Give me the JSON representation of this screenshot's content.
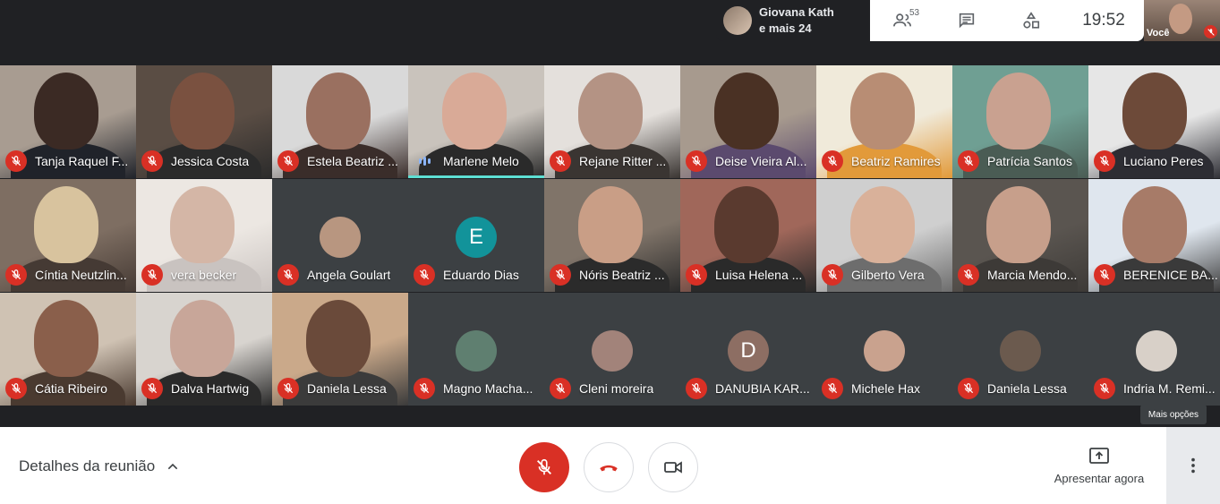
{
  "presenter_chip": {
    "line1": "Giovana Kath",
    "line2": "e mais 24"
  },
  "top_controls": {
    "participants_count": "53",
    "clock": "19:52"
  },
  "self_view": {
    "label": "Você"
  },
  "tiles": [
    {
      "name": "Tanja Raquel F...",
      "kind": "video",
      "colors": [
        "#a89c91",
        "#3b2a24",
        "#20232a"
      ]
    },
    {
      "name": "Jessica Costa",
      "kind": "video",
      "colors": [
        "#5a4d44",
        "#7a5140",
        "#2b2b2b"
      ]
    },
    {
      "name": "Estela Beatriz ...",
      "kind": "video",
      "colors": [
        "#d9d9d9",
        "#9a7060",
        "#3a2d2a"
      ]
    },
    {
      "name": "Marlene Melo",
      "kind": "video",
      "speaking": true,
      "colors": [
        "#c9c3bc",
        "#d9aa97",
        "#2a2a2a"
      ]
    },
    {
      "name": "Rejane Ritter ...",
      "kind": "video",
      "colors": [
        "#e4e0dc",
        "#b49384",
        "#3a3532"
      ]
    },
    {
      "name": "Deise Vieira Al...",
      "kind": "video",
      "colors": [
        "#a79a8e",
        "#4a3124",
        "#5b4a6e"
      ]
    },
    {
      "name": "Beatriz Ramires",
      "kind": "video",
      "colors": [
        "#f0eada",
        "#b88d74",
        "#e29a3a"
      ]
    },
    {
      "name": "Patrícia Santos",
      "kind": "video",
      "colors": [
        "#6f9f93",
        "#c9a190",
        "#4a5c54"
      ]
    },
    {
      "name": "Luciano Peres",
      "kind": "video",
      "colors": [
        "#e6e6e6",
        "#6d4a39",
        "#2d2d33"
      ]
    },
    {
      "name": "Cíntia Neutzlin...",
      "kind": "video",
      "colors": [
        "#7e6e62",
        "#d8c39e",
        "#453a34"
      ]
    },
    {
      "name": "vera becker",
      "kind": "video",
      "colors": [
        "#ece7e2",
        "#d4b6a6",
        "#c9c3c0"
      ]
    },
    {
      "name": "Angela Goulart",
      "kind": "avatar",
      "avatar_color": "#b89680"
    },
    {
      "name": "Eduardo Dias",
      "kind": "letter",
      "letter": "E",
      "avatar_color": "#12939a"
    },
    {
      "name": "Nóris Beatriz ...",
      "kind": "video",
      "colors": [
        "#807469",
        "#c99e86",
        "#2b2b2b"
      ]
    },
    {
      "name": "Luisa Helena ...",
      "kind": "video",
      "colors": [
        "#a0675a",
        "#5a3a2f",
        "#2a2a2a"
      ]
    },
    {
      "name": "Gilberto Vera",
      "kind": "video",
      "colors": [
        "#cfcfcf",
        "#d9b19a",
        "#6d6d6d"
      ]
    },
    {
      "name": "Marcia Mendo...",
      "kind": "video",
      "colors": [
        "#5a5550",
        "#c79f8b",
        "#3d3a37"
      ]
    },
    {
      "name": "BERENICE BA...",
      "kind": "video",
      "colors": [
        "#dfe6ee",
        "#a77b68",
        "#3a3a3a"
      ]
    },
    {
      "name": "Cátia Ribeiro",
      "kind": "video",
      "colors": [
        "#cfc2b3",
        "#8a5f4b",
        "#4a3a30"
      ]
    },
    {
      "name": "Dalva Hartwig",
      "kind": "video",
      "colors": [
        "#d8d4cf",
        "#c8a699",
        "#2a2a2a"
      ]
    },
    {
      "name": "Daniela Lessa",
      "kind": "video",
      "colors": [
        "#caa98a",
        "#6a4a3a",
        "#3b3b3b"
      ]
    },
    {
      "name": "Magno Macha...",
      "kind": "avatar",
      "avatar_color": "#5f7f70"
    },
    {
      "name": "Cleni moreira",
      "kind": "avatar",
      "avatar_color": "#a2837a"
    },
    {
      "name": "DANUBIA KAR...",
      "kind": "letter",
      "letter": "D",
      "avatar_color": "#8d6e63"
    },
    {
      "name": "Michele Hax",
      "kind": "avatar",
      "avatar_color": "#c9a28e"
    },
    {
      "name": "Daniela Lessa",
      "kind": "avatar",
      "avatar_color": "#6b5a4e"
    },
    {
      "name": "Indria M. Remi...",
      "kind": "avatar",
      "avatar_color": "#d8d0c8"
    }
  ],
  "tooltip": "Mais opções",
  "bottom": {
    "details_label": "Detalhes da reunião",
    "present_label": "Apresentar agora"
  }
}
